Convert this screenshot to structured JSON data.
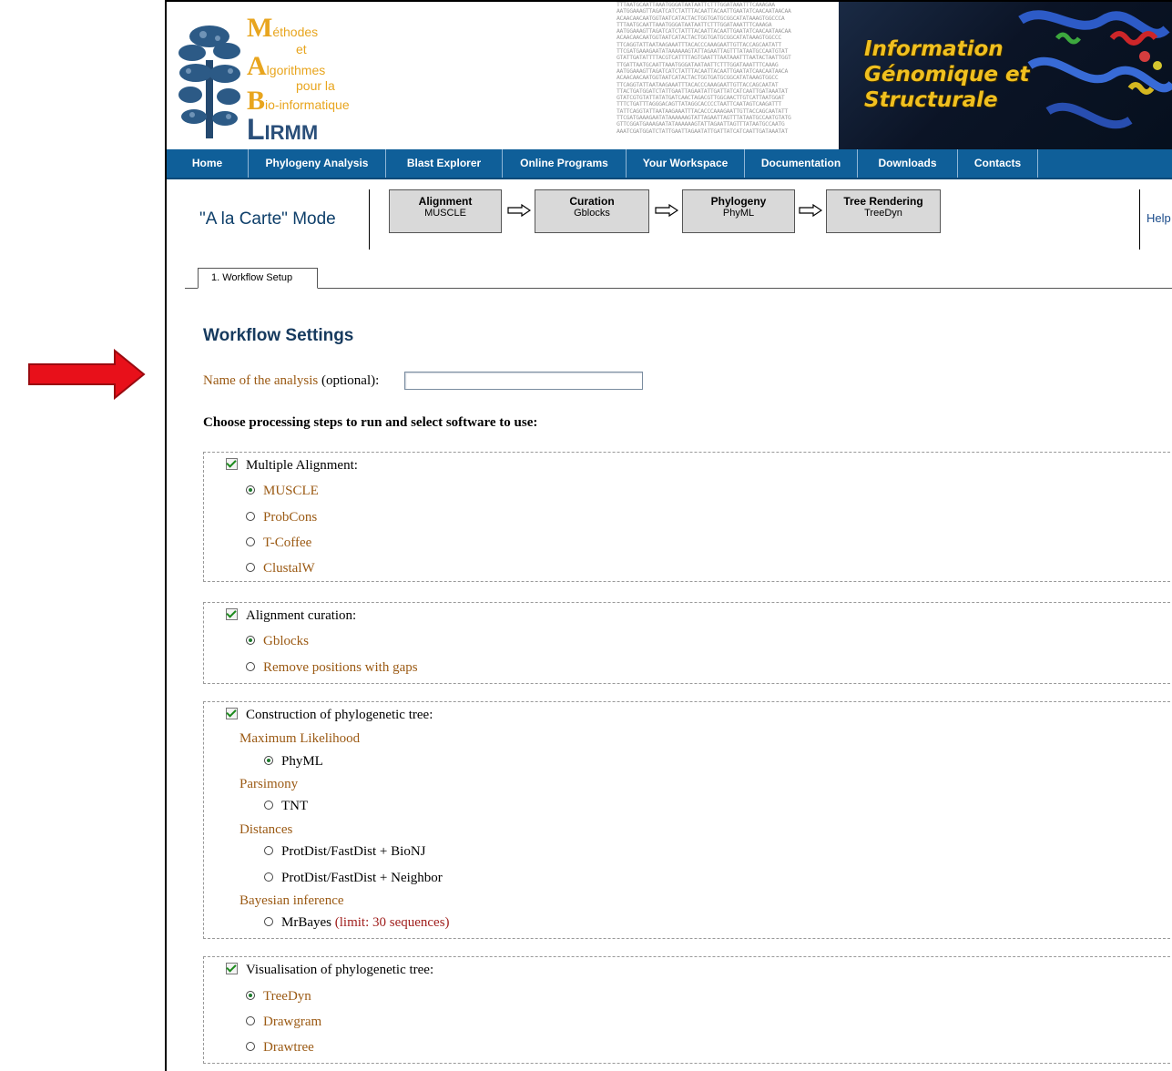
{
  "header": {
    "logo_lines": [
      {
        "big": "M",
        "small": "éthodes"
      },
      {
        "big": "",
        "small": "et"
      },
      {
        "big": "A",
        "small": "lgorithmes"
      },
      {
        "big": "",
        "small": "pour la"
      },
      {
        "big": "B",
        "small": "io-informatique"
      }
    ],
    "lirmm_L": "L",
    "lirmm_rest": "IRMM",
    "banner_lines": [
      "Information",
      "Génomique et",
      "Structurale"
    ],
    "dna_lines": [
      "TTTAATGCAATTAAATGGGATAATAATTCTTTGGATAAATTTCAAAGAA",
      "AATGGAAAGTTAGATCATCTATTTACAATTACAATTGAATATCAACAATAACAA",
      "ACAACAACAATGGTAATCATACTACTGGTGATGCGGCATATAAAGTGGCCCA",
      "TTTAATGCAATTAAATGGGATAATAATTCTTTGGATAAATTTCAAAGA",
      "AATGGAAAGTTAGATCATCTATTTACAATTACAATTGAATATCAACAATAACAA",
      "ACAACAACAATGGTAATCATACTACTGGTGATGCGGCATATAAAGTGGCCC",
      "TTCAGGTATTAATAAGAAATTTACACCCAAAGAATTGTTACCAGCAATATT",
      "TTCGATGAAAGAATATAAAAAAGTATTAGAATTAGTTTATAATGCCAATGTAT",
      "GTATTGATATTTTACGTCATTTTAGTGAATTTAATAAATTTAATACTAATTGGT",
      "TTGATTAATGCAATTAAATGGGATAATAATTCTTTGGATAAATTTCAAAG",
      "AATGGAAAGTTAGATCATCTATTTACAATTACAATTGAATATCAACAATAACA",
      "ACAACAACAATGGTAATCATACTACTGGTGATGCGGCATATAAAGTGGCC",
      "TTCAGGTATTAATAAGAAATTTACACCCAAAGAATTGTTACCAGCAATAT",
      "TTACTGATGGATCTATTGAATTAGAATATTGATTATCATCAATTGATAAATAT",
      "GTATCGTGTATTATATGATCAACTAGACGTTGGCAACTTGTCATTAATGGAT",
      "TTTCTGATTTAGGGACAGTTATAGGCACCCCTAATTCAATAGTCAAGATTT",
      "TATTCAGGTATTAATAAGAAATTTACACCCAAAGAATTGTTACCAGCAATATT",
      "TTCGATGAAAGAATATAAAAAAGTATTAGAATTAGTTTATAATGCCAATGTATG",
      "GTTCGGATGAAAGAATATAAAAAAGTATTAGAATTAGTTTATAATGCCAATG",
      "AAATCGATGGATCTATTGAATTAGAATATTGATTATCATCAATTGATAAATAT"
    ]
  },
  "nav": [
    "Home",
    "Phylogeny Analysis",
    "Blast Explorer",
    "Online Programs",
    "Your Workspace",
    "Documentation",
    "Downloads",
    "Contacts"
  ],
  "workflow": {
    "mode_title": "\"A la Carte\" Mode",
    "steps": [
      {
        "title": "Alignment",
        "tool": "MUSCLE"
      },
      {
        "title": "Curation",
        "tool": "Gblocks"
      },
      {
        "title": "Phylogeny",
        "tool": "PhyML"
      },
      {
        "title": "Tree Rendering",
        "tool": "TreeDyn"
      }
    ],
    "help": "Help"
  },
  "tabs": [
    "1. Workflow Setup"
  ],
  "settings": {
    "title": "Workflow Settings",
    "analysis_label": "Name of the analysis",
    "analysis_optional": "(optional):",
    "analysis_value": "",
    "choose_label": "Choose processing steps to run and select software to use:"
  },
  "groups": {
    "alignment": {
      "label": "Multiple Alignment:",
      "checked": true,
      "options": [
        {
          "label": "MUSCLE",
          "selected": true
        },
        {
          "label": "ProbCons",
          "selected": false
        },
        {
          "label": "T-Coffee",
          "selected": false
        },
        {
          "label": "ClustalW",
          "selected": false
        }
      ]
    },
    "curation": {
      "label": "Alignment curation:",
      "checked": true,
      "options": [
        {
          "label": "Gblocks",
          "selected": true
        },
        {
          "label": "Remove positions with gaps",
          "selected": false
        }
      ]
    },
    "tree": {
      "label": "Construction of phylogenetic tree:",
      "checked": true,
      "categories": [
        {
          "name": "Maximum Likelihood",
          "options": [
            {
              "label": "PhyML",
              "selected": true
            }
          ]
        },
        {
          "name": "Parsimony",
          "options": [
            {
              "label": "TNT",
              "selected": false
            }
          ]
        },
        {
          "name": "Distances",
          "options": [
            {
              "label": "ProtDist/FastDist + BioNJ",
              "selected": false
            },
            {
              "label": "ProtDist/FastDist + Neighbor",
              "selected": false
            }
          ]
        },
        {
          "name": "Bayesian inference",
          "options": [
            {
              "label": "MrBayes",
              "note": "(limit: 30 sequences)",
              "selected": false
            }
          ]
        }
      ]
    },
    "visualisation": {
      "label": "Visualisation of phylogenetic tree:",
      "checked": true,
      "options": [
        {
          "label": "TreeDyn",
          "selected": true
        },
        {
          "label": "Drawgram",
          "selected": false
        },
        {
          "label": "Drawtree",
          "selected": false
        }
      ]
    }
  },
  "colors": {
    "nav_bg": "#0f5f99",
    "label_brown": "#9b5a14",
    "title_blue": "#163a5e",
    "arrow_red": "#e8101a",
    "limit_red": "#a0201e"
  }
}
